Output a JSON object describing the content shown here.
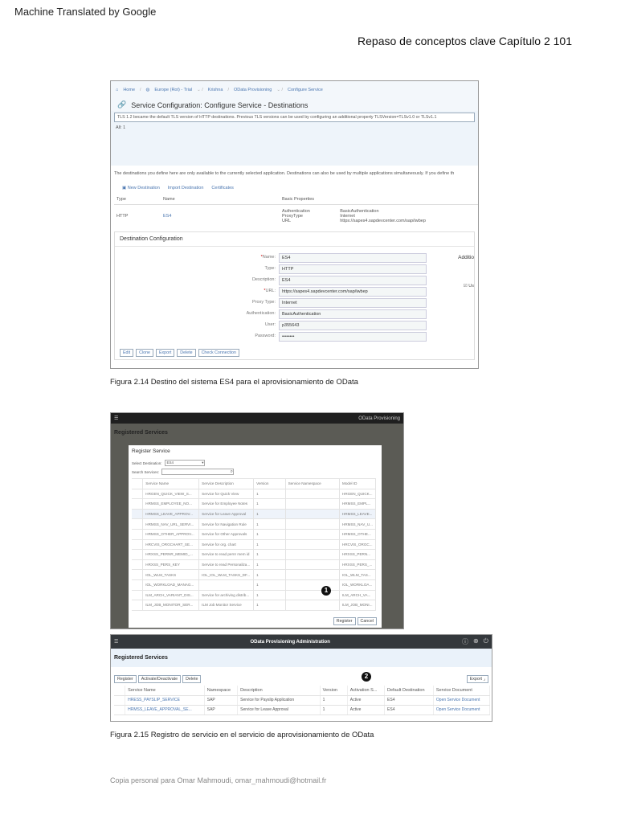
{
  "page": {
    "banner": "Machine Translated by Google",
    "header": "Repaso de conceptos clave Capítulo 2 101",
    "footer": "Copia personal para Omar Mahmoudi, omar_mahmoudi@hotmail.fr"
  },
  "fig1": {
    "breadcrumb": [
      "Home",
      "Europe (Rot) - Trial",
      "Krishna",
      "OData Provisioning",
      "Configure Service"
    ],
    "title": "Service Configuration: Configure Service - Destinations",
    "message": "TLS 1.2 became the default TLS version of HTTP destinations. Previous TLS versions can be used by configuring an additional property TLSVersion=TLSv1.0 or TLSv1.1",
    "all_count": "All: 1",
    "info": "The destinations you define here are only available to the currently selected application. Destinations can also be used by multiple applications simultaneously. If you define th",
    "actions": [
      "New Destination",
      "Import Destination",
      "Certificates"
    ],
    "columns": [
      "Type",
      "Name",
      "Basic Properties"
    ],
    "row": {
      "type": "HTTP",
      "name": "ES4",
      "props": [
        "Authentication",
        "ProxyType",
        "URL"
      ],
      "values": [
        "BasicAuthentication",
        "Internet",
        "https://sapes4.sapdevcenter.com/sap/iwbep"
      ]
    },
    "config_title": "Destination Configuration",
    "additional": "Additio",
    "use_label": "Us",
    "fields": [
      {
        "label": "Name:",
        "value": "ES4",
        "req": "*"
      },
      {
        "label": "Type:",
        "value": "HTTP",
        "req": ""
      },
      {
        "label": "Description:",
        "value": "ES4",
        "req": ""
      },
      {
        "label": "URL:",
        "value": "https://sapes4.sapdevcenter.com/sap/iwbep",
        "req": "*"
      },
      {
        "label": "Proxy Type:",
        "value": "Internet",
        "req": ""
      },
      {
        "label": "Authentication:",
        "value": "BasicAuthentication",
        "req": ""
      },
      {
        "label": "User:",
        "value": "p355643",
        "req": ""
      },
      {
        "label": "Password:",
        "value": "••••••••",
        "req": ""
      }
    ],
    "buttons": [
      "Edit",
      "Clone",
      "Export",
      "Delete",
      "Check Connection"
    ],
    "caption": "Figura 2.14 Destino del sistema ES4 para el aprovisionamiento de OData"
  },
  "fig2": {
    "app_title": "OData Provisioning",
    "page_title": "Registered Services",
    "dialog_title": "Register Service",
    "dest_label": "Select Destination:",
    "dest_value": "ES4",
    "search_label": "Search Services:",
    "search_value": "",
    "columns": [
      "Service Name",
      "Service Description",
      "Version",
      "Service Namespace",
      "Model ID"
    ],
    "rows": [
      [
        "HRGEN_QUICK_VIEW_S...",
        "Service for Quick View",
        "1",
        "",
        "HRGEN_QUICK..."
      ],
      [
        "HRMSS_EMPLOYEE_NO...",
        "Service for Employee Notes",
        "1",
        "",
        "HRMSS_EMPL..."
      ],
      [
        "HRMSS_LEAVE_APPROV...",
        "Service for Leave Approval",
        "1",
        "",
        "HRMSS_LEAVE..."
      ],
      [
        "HRMSS_NAV_URL_SERVI...",
        "Service for Navigation Rule",
        "1",
        "",
        "HRMSS_NAV_U..."
      ],
      [
        "HRMSS_OTHER_APPROV...",
        "Service for Other Approvals",
        "1",
        "",
        "HRMSS_OTHE..."
      ],
      [
        "HRCVIS_ORGCHART_SE...",
        "Service for org. chart",
        "1",
        "",
        "HRCVIS_ORGC..."
      ],
      [
        "HRXSS_PERNR_MEMID_...",
        "Service to read pernr mem id",
        "1",
        "",
        "HRXSS_PERN..."
      ],
      [
        "HRXSS_PERS_KEY",
        "Service to read Personaliza...",
        "1",
        "",
        "HRXSS_PERS_..."
      ],
      [
        "IOL_WLM_TASKS",
        "IOL_IOL_WLM_TASKS_DF...",
        "1",
        "",
        "IOL_WLM_TAS..."
      ],
      [
        "IOL_WORKLOAD_MANAG...",
        "",
        "1",
        "",
        "IOL_WORKLOA..."
      ],
      [
        "ILM_ARCH_VARIANT_DIS...",
        "Service for archiving distrib...",
        "1",
        "",
        "ILM_ARCH_VA..."
      ],
      [
        "ILM_JOB_MONITOR_SER...",
        "ILM Job Monitor Service",
        "1",
        "",
        "ILM_JOB_MONI..."
      ]
    ],
    "selected_row": 2,
    "marker": "1",
    "buttons": [
      "Register",
      "Cancel"
    ]
  },
  "fig3": {
    "app_title": "OData Provisioning Administration",
    "page_title": "Registered Services",
    "buttons": [
      "Register",
      "Activate/Deactivate",
      "Delete"
    ],
    "export": "Export",
    "marker": "2",
    "columns": [
      "Service Name",
      "Namespace",
      "Description",
      "Version",
      "Activation S...",
      "Default Destination",
      "Service Document"
    ],
    "rows": [
      [
        "HRESS_PAYSLIP_SERVICE",
        "SAP",
        "Service for Payslip Application",
        "1",
        "Active",
        "ES4",
        "Open Service Document"
      ],
      [
        "HRMSS_LEAVE_APPROVAL_SE...",
        "SAP",
        "Service for Leave Approval",
        "1",
        "Active",
        "ES4",
        "Open Service Document"
      ]
    ],
    "caption": "Figura 2.15 Registro de servicio en el servicio de aprovisionamiento de OData"
  }
}
